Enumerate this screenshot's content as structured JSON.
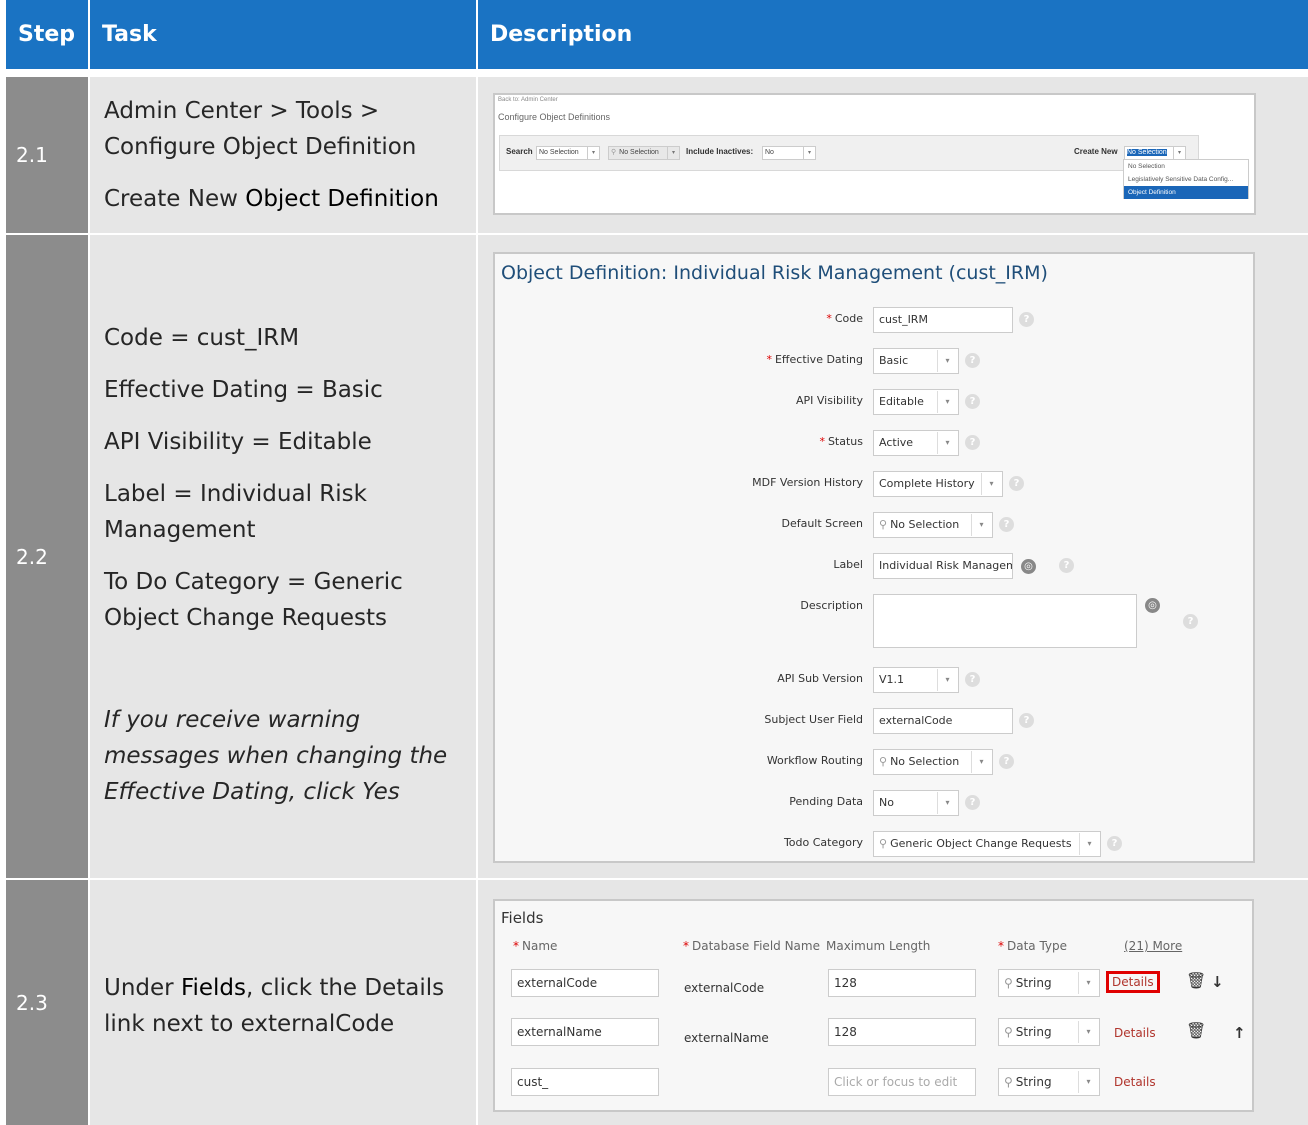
{
  "header": {
    "step": "Step",
    "task": "Task",
    "description": "Description"
  },
  "rows": [
    {
      "step": "2.1",
      "task": {
        "line1": "Admin Center > Tools >",
        "line2": "Configure Object Definition",
        "line3_plain": "Create New ",
        "line3_bold": "Object Definition"
      },
      "screenshot": {
        "back": "Back to: Admin Center",
        "title": "Configure Object Definitions",
        "search_label": "Search",
        "search_value": "No Selection",
        "search2_value": "No Selection",
        "include_label": "Include Inactives:",
        "include_value": "No",
        "create_label": "Create New",
        "create_value": "No Selection",
        "dropdown": [
          "No Selection",
          "Legislatively Sensitive Data Config...",
          "Object Definition"
        ]
      }
    },
    {
      "step": "2.2",
      "task": {
        "l1": "Code = cust_IRM",
        "l2": "Effective Dating = Basic",
        "l3": "API Visibility = Editable",
        "l4": "Label = Individual Risk Management",
        "l5": "To Do Category = Generic Object Change Requests",
        "note": "If you receive warning messages when changing the Effective Dating, click Yes"
      },
      "screenshot": {
        "title": "Object Definition: Individual Risk Management (cust_IRM)",
        "fields": {
          "code": {
            "label": "Code",
            "value": "cust_IRM"
          },
          "effective_dating": {
            "label": "Effective Dating",
            "value": "Basic"
          },
          "api_visibility": {
            "label": "API Visibility",
            "value": "Editable"
          },
          "status": {
            "label": "Status",
            "value": "Active"
          },
          "mdf_version": {
            "label": "MDF Version History",
            "value": "Complete History"
          },
          "default_screen": {
            "label": "Default Screen",
            "value": "No Selection"
          },
          "label": {
            "label": "Label",
            "value": "Individual Risk Managem"
          },
          "description": {
            "label": "Description",
            "value": ""
          },
          "api_sub_version": {
            "label": "API Sub Version",
            "value": "V1.1"
          },
          "subject_user_field": {
            "label": "Subject User Field",
            "value": "externalCode"
          },
          "workflow_routing": {
            "label": "Workflow Routing",
            "value": "No Selection"
          },
          "pending_data": {
            "label": "Pending Data",
            "value": "No"
          },
          "todo_category": {
            "label": "Todo Category",
            "value": "Generic Object Change Requests"
          }
        }
      }
    },
    {
      "step": "2.3",
      "task": {
        "plain1": "Under ",
        "bold": "Fields",
        "plain2": ", click the Details link next to externalCode"
      },
      "screenshot": {
        "title": "Fields",
        "columns": {
          "name": "Name",
          "db_field": "Database Field Name",
          "max_length": "Maximum Length",
          "data_type": "Data Type",
          "more": "(21) More"
        },
        "rows": [
          {
            "name": "externalCode",
            "db": "externalCode",
            "max": "128",
            "type": "String",
            "details": "Details"
          },
          {
            "name": "externalName",
            "db": "externalName",
            "max": "128",
            "type": "String",
            "details": "Details"
          },
          {
            "name": "cust_",
            "db": "",
            "max_placeholder": "Click or focus to edit",
            "type": "String",
            "details": "Details"
          }
        ]
      }
    }
  ]
}
